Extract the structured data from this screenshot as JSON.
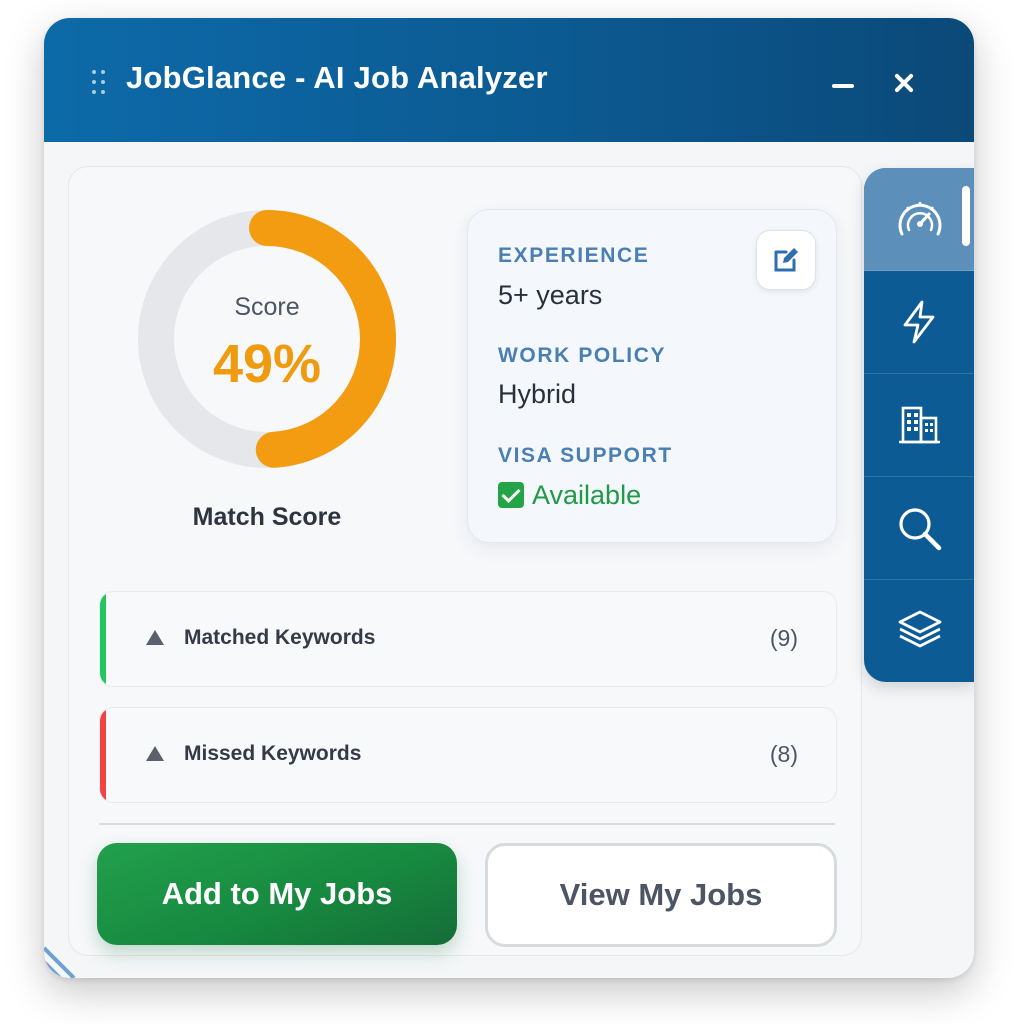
{
  "window": {
    "title": "JobGlance - AI Job Analyzer",
    "icons": {
      "drag": "drag-handle-icon",
      "minimize": "minimize-icon",
      "close": "close-icon"
    }
  },
  "score": {
    "label": "Score",
    "value_text": "49%",
    "percent": 49,
    "caption": "Match Score",
    "color": "#f39c12",
    "track_color": "#e5e7eb"
  },
  "details": {
    "experience_label": "EXPERIENCE",
    "experience_value": "5+ years",
    "work_policy_label": "WORK POLICY",
    "work_policy_value": "Hybrid",
    "visa_label": "VISA SUPPORT",
    "visa_value": "Available",
    "edit_icon": "edit-icon"
  },
  "keywords": {
    "matched": {
      "label": "Matched Keywords",
      "count": "(9)",
      "color": "#22c55e"
    },
    "missed": {
      "label": "Missed Keywords",
      "count": "(8)",
      "color": "#ef4444"
    }
  },
  "actions": {
    "add_label": "Add to My Jobs",
    "view_label": "View My Jobs"
  },
  "sidebar": {
    "items": [
      {
        "icon": "gauge-icon",
        "active": true
      },
      {
        "icon": "lightning-icon",
        "active": false
      },
      {
        "icon": "building-icon",
        "active": false
      },
      {
        "icon": "search-icon",
        "active": false
      },
      {
        "icon": "layers-icon",
        "active": false
      }
    ]
  },
  "colors": {
    "titlebar": "#0c5a92",
    "accent_blue": "#4a7fb4",
    "primary_green": "#178a40"
  }
}
